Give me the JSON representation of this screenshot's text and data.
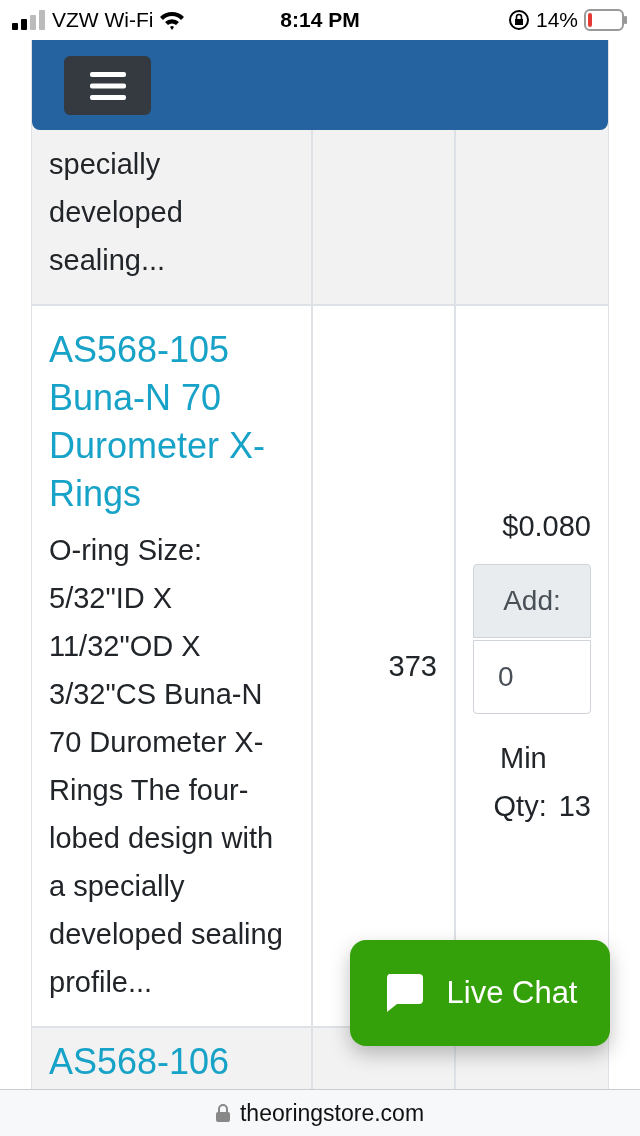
{
  "status_bar": {
    "carrier": "VZW Wi-Fi",
    "time": "8:14 PM",
    "battery": "14%"
  },
  "products": [
    {
      "description": "specially developed sealing..."
    },
    {
      "title": "AS568-105 Buna-N 70 Durometer X-Rings",
      "description": "O-ring Size: 5/32\"ID X 11/32\"OD X 3/32\"CS Buna-N 70 Durometer X-Rings The four-lobed design with a specially developed sealing profile...",
      "stock": "373",
      "price": "$0.080",
      "add_label": "Add:",
      "quantity": "0",
      "min_qty_label": "Min Qty:",
      "min_qty": "13"
    },
    {
      "title": "AS568-106"
    }
  ],
  "live_chat": {
    "label": "Live Chat"
  },
  "address_bar": {
    "url": "theoringstore.com"
  }
}
